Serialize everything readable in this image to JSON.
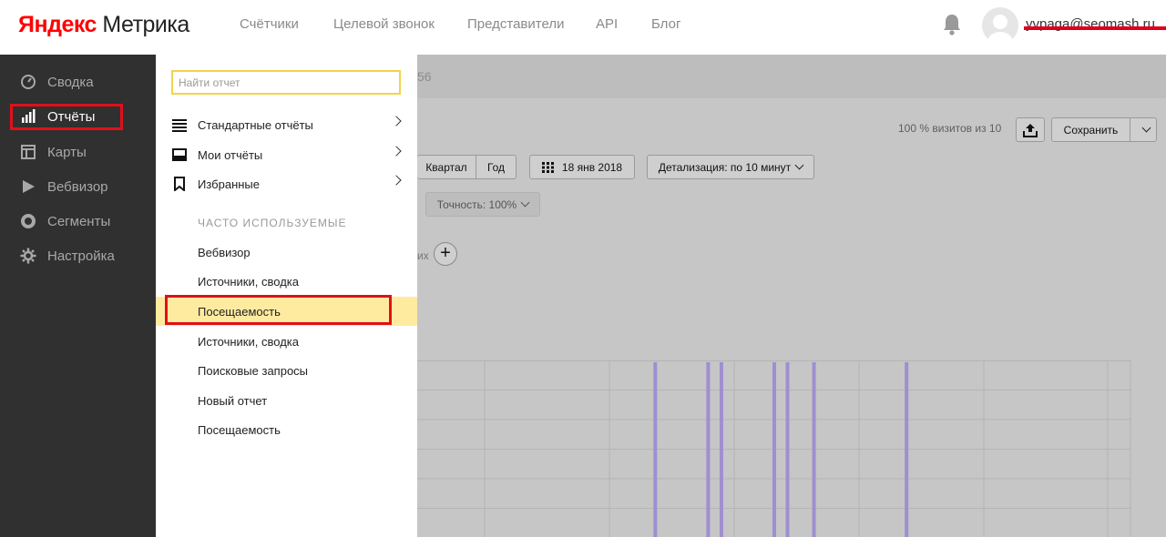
{
  "header": {
    "logo_ya": "Яндекс",
    "logo_product": "Метрика",
    "nav": [
      {
        "label": "Счётчики"
      },
      {
        "label": "Целевой звонок"
      },
      {
        "label": "Представители"
      },
      {
        "label": "API"
      },
      {
        "label": "Блог"
      }
    ],
    "user_email": "yvpaga@seomash.ru",
    "icons": {
      "notifications": "bell-icon",
      "avatar": "user-avatar"
    }
  },
  "sidebar": {
    "items": [
      {
        "label": "Сводка",
        "icon": "gauge-icon"
      },
      {
        "label": "Отчёты",
        "icon": "bar-chart-icon",
        "active": true
      },
      {
        "label": "Карты",
        "icon": "map-layout-icon"
      },
      {
        "label": "Вебвизор",
        "icon": "play-icon"
      },
      {
        "label": "Сегменты",
        "icon": "donut-icon"
      },
      {
        "label": "Настройка",
        "icon": "gear-icon"
      }
    ]
  },
  "report_menu": {
    "search_placeholder": "Найти отчет",
    "sections": [
      {
        "label": "Стандартные отчёты",
        "icon": "list-icon"
      },
      {
        "label": "Мои отчёты",
        "icon": "inbox-icon"
      },
      {
        "label": "Избранные",
        "icon": "bookmark-icon"
      }
    ],
    "frequent_heading": "ЧАСТО ИСПОЛЬЗУЕМЫЕ",
    "frequent": [
      {
        "label": "Вебвизор"
      },
      {
        "label": "Источники, сводка"
      },
      {
        "label": "Посещаемость",
        "selected": true
      },
      {
        "label": "Источники, сводка"
      },
      {
        "label": "Поисковые запросы"
      },
      {
        "label": "Новый отчет"
      },
      {
        "label": "Посещаемость"
      }
    ]
  },
  "main": {
    "band_text": "56",
    "visits_text": "100 % визитов из 10",
    "save_label": "Сохранить",
    "period_buttons": [
      "Квартал",
      "Год"
    ],
    "date_label": "18 янв 2018",
    "detail_label": "Детализация: по 10 минут",
    "accuracy_label": "Точность: 100%",
    "axis_fragment": "их",
    "add_label": "+"
  },
  "colors": {
    "sidebar_bg": "#303030",
    "overlay_bg": "#c6c6c6",
    "highlight_row": "#ffeba0",
    "search_border": "#f3d34a",
    "annotation_red": "#e0101a",
    "spike_color": "#9f8fd0"
  },
  "chart_data": {
    "type": "bar",
    "description_series": "visits spikes",
    "spike_slots": [
      18,
      22,
      23,
      27,
      28,
      30,
      37
    ],
    "slot_count": 54
  }
}
